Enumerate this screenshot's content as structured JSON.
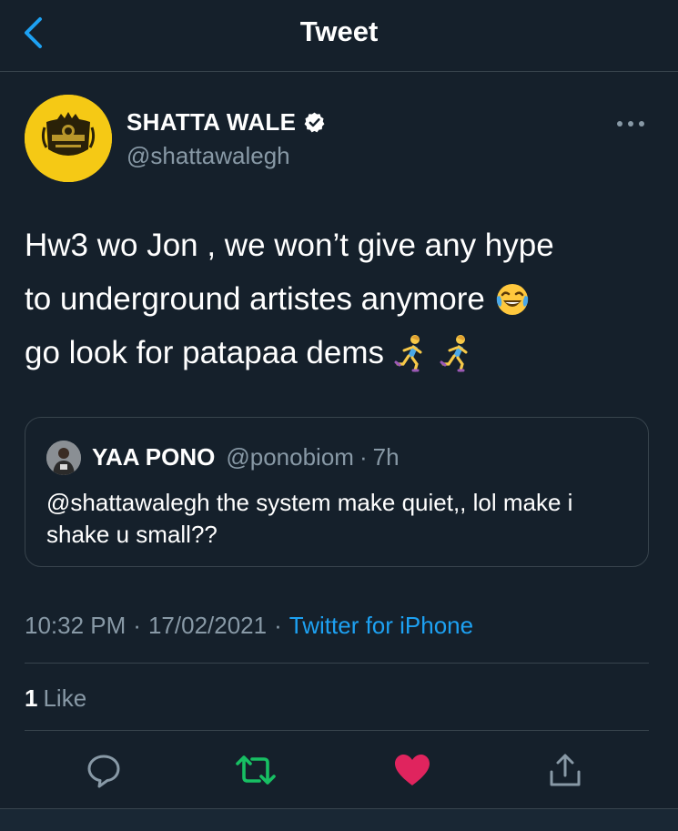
{
  "header": {
    "title": "Tweet",
    "back_icon": "chevron-left-icon",
    "accent_color": "#1da1f2"
  },
  "author": {
    "name": "SHATTA WALE",
    "handle": "@shattawalegh",
    "verified": true,
    "avatar_bg": "#f5c915"
  },
  "tweet": {
    "lines": [
      "Hw3 wo Jon , we won’t give any hype",
      "to underground artistes anymore",
      "go look for patapaa dems"
    ],
    "emojis": [
      "face-with-tears-of-joy",
      "woman-running",
      "woman-running"
    ]
  },
  "quote": {
    "name": "YAA PONO",
    "handle": "@ponobiom",
    "separator": "·",
    "time": "7h",
    "text": "@shattawalegh the system make quiet,, lol make i shake u small??"
  },
  "meta": {
    "time": "10:32 PM",
    "separator": "·",
    "date": "17/02/2021",
    "source": "Twitter for iPhone"
  },
  "stats": {
    "likes_count": "1",
    "likes_label": "Like"
  },
  "actions": {
    "reply_icon": "reply-icon",
    "retweet_icon": "retweet-icon",
    "like_icon": "heart-icon",
    "share_icon": "share-icon",
    "retweet_color": "#17bf63",
    "like_color": "#e0245e"
  },
  "colors": {
    "background": "#15202b",
    "secondary_text": "#8899a6",
    "border": "#38444d"
  }
}
